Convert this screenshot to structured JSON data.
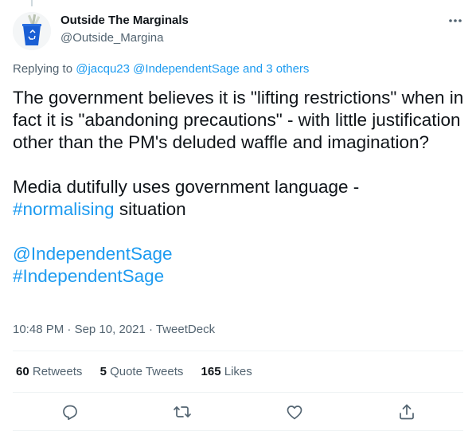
{
  "author": {
    "display_name": "Outside The Marginals",
    "handle": "@Outside_Margina"
  },
  "reply": {
    "prefix": "Replying to ",
    "mentions": [
      "@jacqu23",
      "@IndependentSage"
    ],
    "others": "and 3 others"
  },
  "tweet": {
    "line1": "The government believes it is \"lifting restrictions\" when in fact it is \"abandoning precautions\" - with little justification other than the PM's deluded waffle and imagination?",
    "line2_prefix": "Media dutifully uses government language - ",
    "hashtag_normalising": "#normalising",
    "line2_suffix": " situation",
    "mention_sage": "@IndependentSage",
    "hashtag_sage": "#IndependentSage"
  },
  "meta": {
    "time": "10:48 PM",
    "separator": " · ",
    "date": "Sep 10, 2021",
    "source": "TweetDeck"
  },
  "stats": {
    "retweets_count": "60",
    "retweets_label": "Retweets",
    "quotes_count": "5",
    "quotes_label": "Quote Tweets",
    "likes_count": "165",
    "likes_label": "Likes"
  },
  "colors": {
    "link": "#1d9bf0",
    "secondary_text": "#536471",
    "divider": "#eff3f4",
    "avatar_bin": "#1a5fd4"
  },
  "icons": {
    "avatar": "recycle-bin-avatar",
    "more": "more-horizontal-icon",
    "reply": "reply-icon",
    "retweet": "retweet-icon",
    "like": "heart-icon",
    "share": "share-icon"
  }
}
